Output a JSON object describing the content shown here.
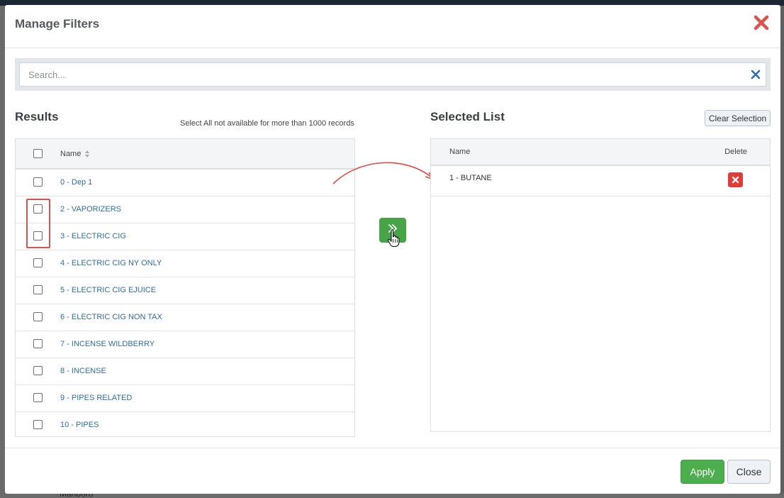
{
  "modal": {
    "title": "Manage Filters"
  },
  "search": {
    "placeholder": "Search...",
    "value": ""
  },
  "results": {
    "title": "Results",
    "note": "Select All not available for more than 1000 records",
    "column_name": "Name",
    "rows": [
      {
        "label": "0 - Dep 1",
        "checked": false
      },
      {
        "label": "2 - VAPORIZERS",
        "checked": false
      },
      {
        "label": "3 - ELECTRIC CIG",
        "checked": false
      },
      {
        "label": "4 - ELECTRIC CIG NY ONLY",
        "checked": false
      },
      {
        "label": "5 - ELECTRIC CIG EJUICE",
        "checked": false
      },
      {
        "label": "6 - ELECTRIC CIG NON TAX",
        "checked": false
      },
      {
        "label": "7 - INCENSE WILDBERRY",
        "checked": false
      },
      {
        "label": "8 - INCENSE",
        "checked": false
      },
      {
        "label": "9 - PIPES RELATED",
        "checked": false
      },
      {
        "label": "10 - PIPES",
        "checked": false
      }
    ]
  },
  "selected": {
    "title": "Selected List",
    "clear_label": "Clear Selection",
    "column_name": "Name",
    "column_delete": "Delete",
    "rows": [
      {
        "label": "1 - BUTANE"
      }
    ]
  },
  "footer": {
    "apply_label": "Apply",
    "close_label": "Close"
  },
  "background": {
    "partial_text": "Marlboro"
  },
  "icons": {
    "close": "close-icon",
    "search_clear": "clear-search-icon",
    "sort": "sort-icon",
    "move": "double-chevron-right-icon",
    "delete": "delete-icon",
    "cursor": "hand-cursor-icon"
  },
  "colors": {
    "accent_green": "#4cae4c",
    "danger_red": "#e23c36",
    "link_blue": "#2f6da3",
    "close_red": "#d9534f"
  }
}
